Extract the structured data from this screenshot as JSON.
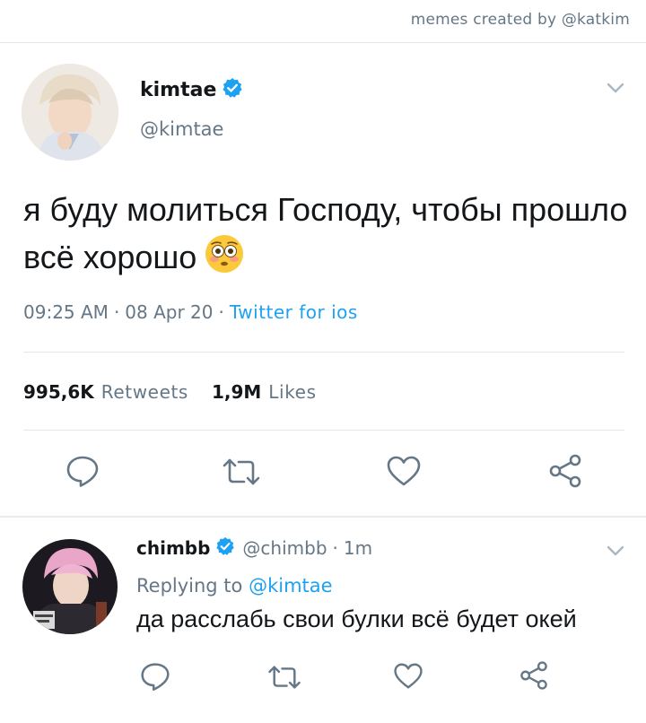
{
  "credit": "memes created by @katkim",
  "tweet": {
    "author_name": "kimtae",
    "author_handle": "@kimtae",
    "text": "я буду молиться Господу, чтобы прошло всё хорошо",
    "emoji": "flushed-face",
    "time": "09:25 AM",
    "date": "08 Apr 20",
    "source": "Twitter for ios",
    "retweets_count": "995,6K",
    "retweets_label": "Retweets",
    "likes_count": "1,9M",
    "likes_label": "Likes"
  },
  "reply": {
    "author_name": "chimbb",
    "author_handle": "@chimbb",
    "time": "1m",
    "replying_label": "Replying to",
    "replying_to": "@kimtae",
    "text": "да расслабь свои булки всё будет окей"
  },
  "colors": {
    "accent": "#1da1f2",
    "secondary_text": "#657786",
    "action_icon": "#657786",
    "divider": "#e1e8ed"
  }
}
